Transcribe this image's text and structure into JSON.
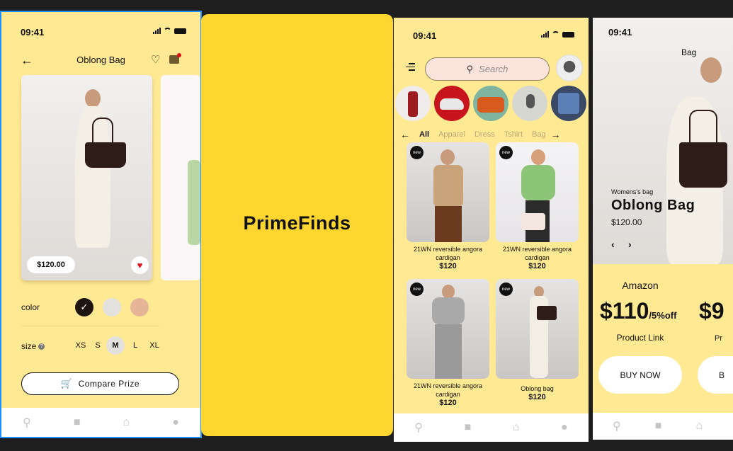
{
  "status": {
    "time": "09:41"
  },
  "detail": {
    "title": "Oblong Bag",
    "price": "$120.00",
    "color_label": "color",
    "size_label": "size",
    "sizes": [
      "XS",
      "S",
      "M",
      "L",
      "XL"
    ],
    "selected_size": "M",
    "compare_button": "Compare Prize",
    "colors": [
      "#1e1510",
      "#e3e1de",
      "#e6b497"
    ]
  },
  "splash": {
    "brand": "PrimeFinds",
    "bg": "#ffd62f"
  },
  "browse": {
    "search_placeholder": "Search",
    "categories": [
      "All",
      "Apparel",
      "Dress",
      "Tshirt",
      "Bag"
    ],
    "badge": "new",
    "products": [
      {
        "name": "21WN reversible angora cardigan",
        "price": "$120"
      },
      {
        "name": "21WN reversible angora cardigan",
        "price": "$120"
      },
      {
        "name": "21WN reversible angora cardigan",
        "price": "$120"
      },
      {
        "name": "Oblong bag",
        "price": "$120"
      }
    ]
  },
  "offer": {
    "category": "Womens's bag",
    "title": "Oblong Bag",
    "price": "$120.00",
    "hero_label": "Bag",
    "store1": "Amazon",
    "price1": "$110",
    "discount1": "/5%off",
    "link1": "Product Link",
    "buy1": "BUY NOW",
    "price2_partial": "$9",
    "link2_partial": "Pr",
    "buy2_partial": "B"
  },
  "colors": {
    "screen_bg": "#ffe993",
    "accent_heart": "#e0101a",
    "selection_outline": "#1f8fff"
  }
}
